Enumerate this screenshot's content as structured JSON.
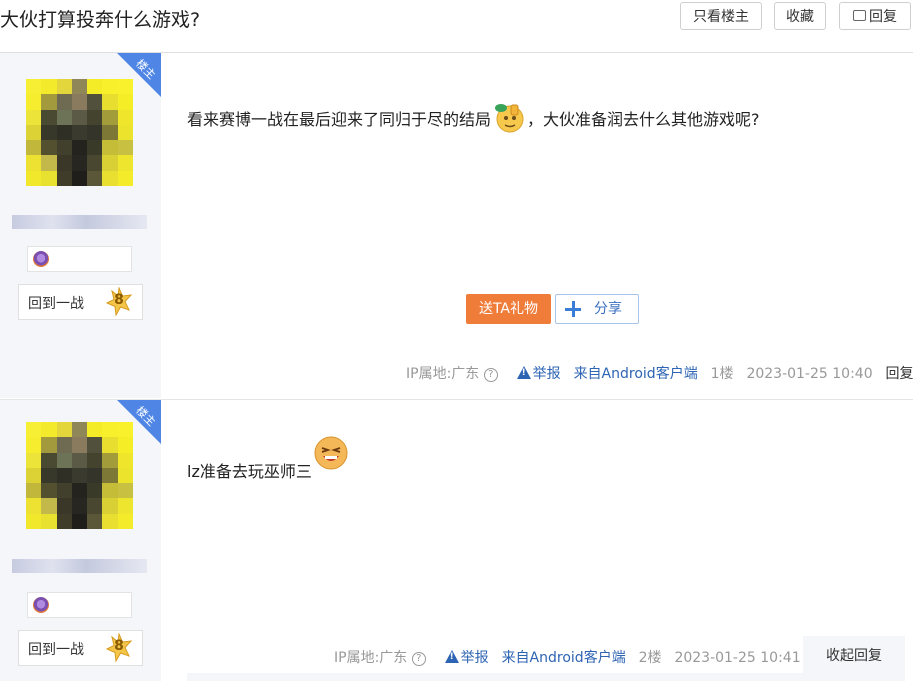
{
  "thread": {
    "title": "大伙打算投奔什么游戏?"
  },
  "header_buttons": {
    "only_op": "只看楼主",
    "favorite": "收藏",
    "reply": "回复"
  },
  "posts": [
    {
      "corner_label": "楼主",
      "level_name": "回到一战",
      "level_num": "8",
      "content_before": "看来赛博一战在最后迎来了同归于尽的结局",
      "content_after": "，大伙准备润去什么其他游戏呢?",
      "gift_button": "送TA礼物",
      "share_button": "分享",
      "ip": "IP属地:广东",
      "report": "举报",
      "client": "来自Android客户端",
      "floor": "1楼",
      "time": "2023-01-25 10:40",
      "reply": "回复"
    },
    {
      "corner_label": "楼主",
      "level_name": "回到一战",
      "level_num": "8",
      "content": "lz准备去玩巫师三",
      "ip": "IP属地:广东",
      "report": "举报",
      "client": "来自Android客户端",
      "floor": "2楼",
      "time": "2023-01-25 10:41",
      "collapse_reply": "收起回复"
    }
  ],
  "colors": {
    "gift_button": "#f07c3a",
    "link_blue": "#2d64b3",
    "corner_blue": "#4f86e6"
  }
}
